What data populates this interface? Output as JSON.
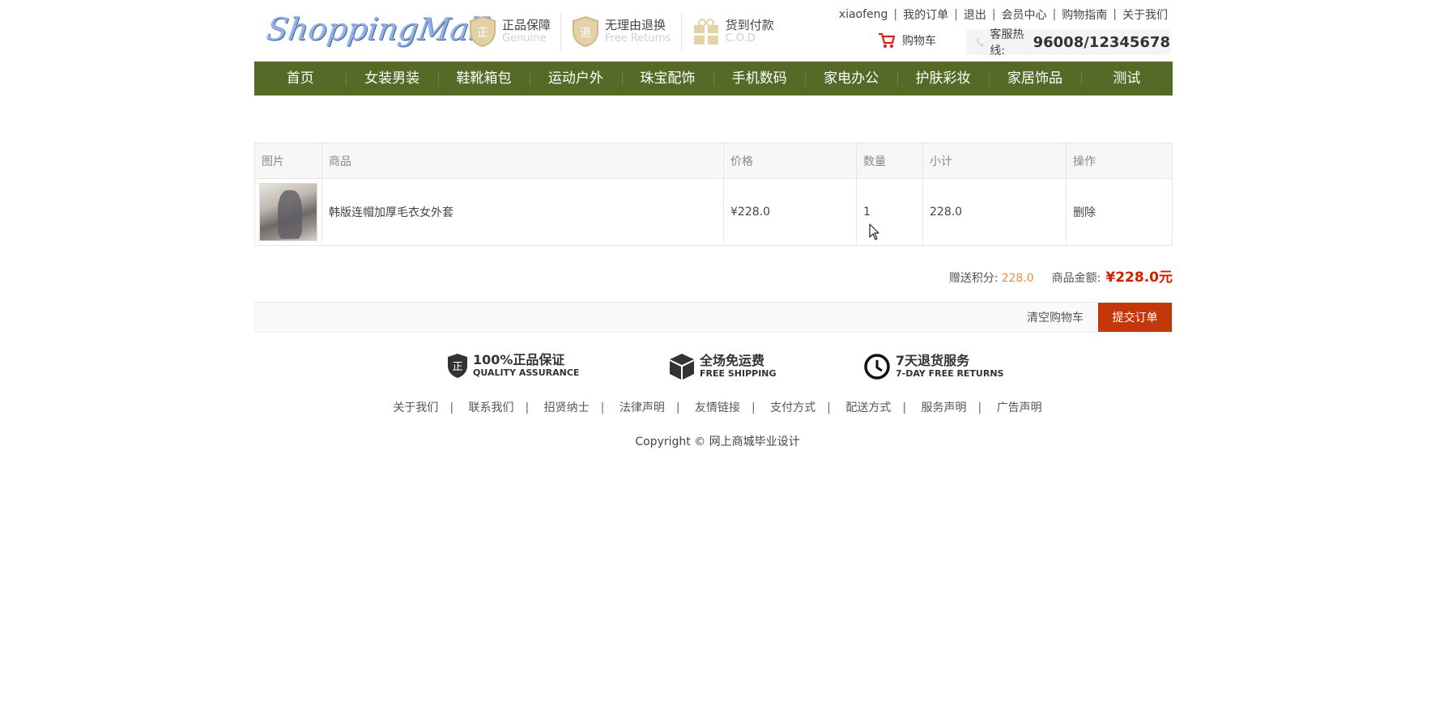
{
  "header": {
    "logo_text": "ShoppingMall",
    "badges": [
      {
        "title": "正品保障",
        "subtitle": "Genuine"
      },
      {
        "title": "无理由退换",
        "subtitle": "Free Returns"
      },
      {
        "title": "货到付款",
        "subtitle": "C.O.D"
      }
    ],
    "user_links": [
      "xiaofeng",
      "我的订单",
      "退出",
      "会员中心",
      "购物指南",
      "关于我们"
    ],
    "cart_label": "购物车",
    "hotline_label": "客服热线:",
    "hotline_number": "96008/12345678"
  },
  "nav": {
    "items": [
      "首页",
      "女装男装",
      "鞋靴箱包",
      "运动户外",
      "珠宝配饰",
      "手机数码",
      "家电办公",
      "护肤彩妆",
      "家居饰品",
      "测试"
    ]
  },
  "cart": {
    "columns": [
      "图片",
      "商品",
      "价格",
      "数量",
      "小计",
      "操作"
    ],
    "rows": [
      {
        "name": "韩版连帽加厚毛衣女外套",
        "price": "¥228.0",
        "quantity": "1",
        "subtotal": "228.0",
        "action": "删除"
      }
    ],
    "points_label": "赠送积分:",
    "points_value": "228.0",
    "amount_label": "商品金额:",
    "amount_value": "¥228.0元",
    "clear_label": "清空购物车",
    "submit_label": "提交订单"
  },
  "footer": {
    "guarantees": [
      {
        "title": "100%正品保证",
        "subtitle": "QUALITY ASSURANCE",
        "icon": "shield-icon"
      },
      {
        "title": "全场免运费",
        "subtitle": "FREE SHIPPING",
        "icon": "box-icon"
      },
      {
        "title": "7天退货服务",
        "subtitle": "7-DAY FREE RETURNS",
        "icon": "clock-icon"
      }
    ],
    "links": [
      "关于我们",
      "联系我们",
      "招贤纳士",
      "法律声明",
      "友情链接",
      "支付方式",
      "配送方式",
      "服务声明",
      "广告声明"
    ],
    "copyright": "Copyright © 网上商城毕业设计"
  }
}
